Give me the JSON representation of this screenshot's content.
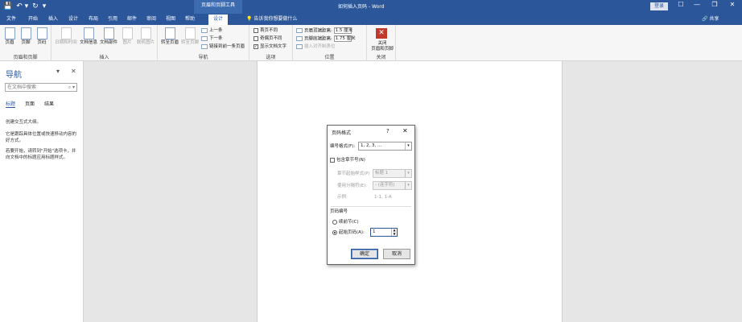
{
  "titlebar": {
    "contextual_tools": "页眉和页脚工具",
    "doc_title": "如何插入页码 - Word",
    "login": "登录",
    "qat": [
      "💾",
      "↶ ▾",
      "↻",
      "▾"
    ],
    "min": "—",
    "restore": "❐",
    "close": "✕",
    "options": "☐"
  },
  "tabs": [
    "文件",
    "开始",
    "插入",
    "设计",
    "布局",
    "引用",
    "邮件",
    "审阅",
    "视图",
    "帮助"
  ],
  "active_tab": "设计",
  "tellme": "💡 告诉我你想要做什么",
  "share": "🔗 共享",
  "ribbon": {
    "hf_group": {
      "label": "页眉和页脚",
      "buttons": [
        "页眉",
        "页脚",
        "页码"
      ]
    },
    "insert_group": {
      "label": "插入",
      "buttons": [
        "日期和时间",
        "文档信息",
        "文档部件",
        "图片",
        "联机图片"
      ]
    },
    "nav_group": {
      "label": "导航",
      "buttons": [
        "转至页眉",
        "转至页脚"
      ],
      "small": [
        "上一条",
        "下一条",
        "链接到前一条页眉"
      ]
    },
    "options_group": {
      "label": "选项",
      "items": [
        {
          "label": "首页不同",
          "checked": false
        },
        {
          "label": "奇偶页不同",
          "checked": false
        },
        {
          "label": "显示文档文字",
          "checked": true
        }
      ]
    },
    "position_group": {
      "label": "位置",
      "header_label": "页眉顶端距离:",
      "header_value": "1.5 厘米",
      "footer_label": "页脚底端距离:",
      "footer_value": "1.75 厘米",
      "align_tab": "插入对齐制表位"
    },
    "close_group": {
      "label": "关闭",
      "button": "关闭\n页眉和页脚",
      "icon": "✕"
    }
  },
  "navpane": {
    "title": "导航",
    "dropdown": "▾",
    "close": "✕",
    "search_placeholder": "在文档中搜索",
    "search_icon": "⌕ ▾",
    "tabs": [
      "标题",
      "页面",
      "结果"
    ],
    "active_tab": "标题",
    "text1": "创建交互式大纲。",
    "text2": "它是跟踪具体位置或快速移动内容的好方式。",
    "text3": "若要开始，请转到\"开始\"选项卡，并向文档中的标题应用标题样式。"
  },
  "dialog": {
    "title": "页码格式",
    "help": "?",
    "close": "✕",
    "number_format_label": "编号格式(F):",
    "number_format_value": "1, 2, 3, …",
    "include_chapter_label": "包含章节号(N)",
    "include_chapter_checked": false,
    "chapter_style_label": "章节起始样式(P)",
    "chapter_style_value": "标题 1",
    "separator_label": "使用分隔符(E):",
    "separator_value": "-  (连字符)",
    "example_label": "示例:",
    "example_value": "1-1, 1-A",
    "numbering_section": "页码编号",
    "continue_label": "续前节(C)",
    "start_at_label": "起始页码(A):",
    "start_at_value": "1",
    "selected_option": "start_at",
    "ok": "确定",
    "cancel": "取消",
    "dropdown_arrow": "▾"
  }
}
